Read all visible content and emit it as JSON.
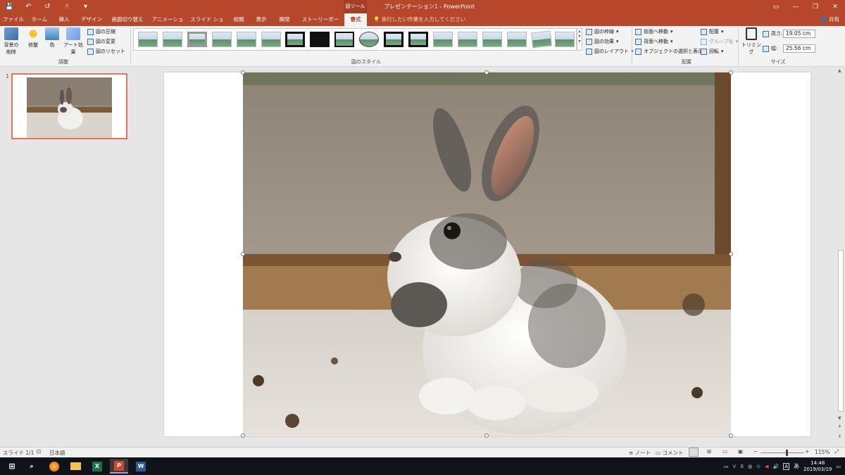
{
  "window": {
    "title": "プレゼンテーション1 - PowerPoint",
    "context_tool": "図ツール",
    "share": "共有",
    "minimize": "—",
    "restore": "❐",
    "close": "✕",
    "ribbon_display": "▭"
  },
  "qat": {
    "save": "💾",
    "undo": "↶",
    "redo": "↺",
    "customize": "▾"
  },
  "tabs": [
    "ファイル",
    "ホーム",
    "挿入",
    "デザイン",
    "画面切り替え",
    "アニメーション",
    "スライド ショー",
    "校閲",
    "表示",
    "開発",
    "ストーリーボード",
    "書式"
  ],
  "active_tab": "書式",
  "tell_me": "実行したい作業を入力してください",
  "ribbon": {
    "remove_bg": "背景の削除",
    "corrections": "修整",
    "color": "色",
    "artistic": "アート効果",
    "compress": "図の圧縮",
    "change": "図の変更",
    "reset": "図のリセット",
    "group_adjust": "調整",
    "group_styles": "図のスタイル",
    "border": "図の枠線",
    "effects": "図の効果",
    "layout": "図のレイアウト",
    "bring_forward": "前面へ移動",
    "send_backward": "背面へ移動",
    "selection_pane": "オブジェクトの選択と表示",
    "align": "配置",
    "group": "グループ化",
    "rotate": "回転",
    "group_arrange": "配置",
    "crop": "トリミング",
    "height_label": "高さ:",
    "height_value": "19.05 cm",
    "width_label": "幅:",
    "width_value": "25.56 cm",
    "group_size": "サイズ"
  },
  "slides": {
    "current_number": "1"
  },
  "status": {
    "slide": "スライド 1/1",
    "language": "日本語",
    "notes": "ノート",
    "comments": "コメント",
    "zoom": "115%",
    "zoom_level": 0.6
  },
  "taskbar": {
    "time": "14:48",
    "date": "2019/03/19",
    "ime": "あ"
  },
  "colors": {
    "accent": "#b7472a",
    "selection": "#e8745a"
  }
}
